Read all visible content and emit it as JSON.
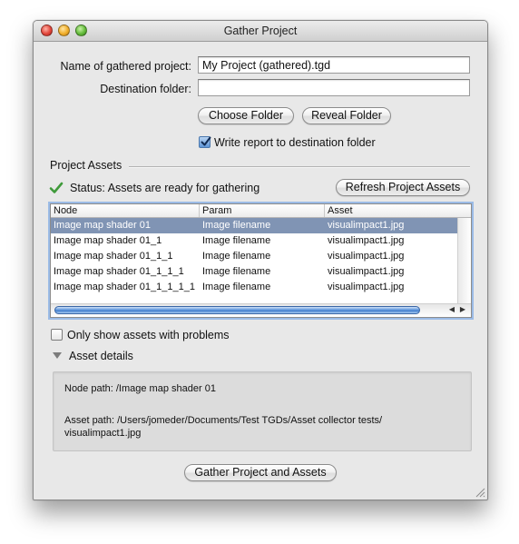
{
  "window": {
    "title": "Gather Project"
  },
  "form": {
    "name_label": "Name of gathered project:",
    "name_value": "My Project (gathered).tgd",
    "dest_label": "Destination folder:",
    "dest_value": "",
    "choose_folder": "Choose Folder",
    "reveal_folder": "Reveal Folder",
    "write_report_label": "Write report to destination folder",
    "write_report_checked": true
  },
  "assets": {
    "section_title": "Project Assets",
    "status": "Status: Assets are ready for gathering",
    "refresh": "Refresh Project Assets",
    "columns": [
      "Node",
      "Param",
      "Asset"
    ],
    "rows": [
      {
        "node": "Image map shader 01",
        "param": "Image filename",
        "asset": "visualimpact1.jpg",
        "selected": true
      },
      {
        "node": "Image map shader 01_1",
        "param": "Image filename",
        "asset": "visualimpact1.jpg",
        "selected": false
      },
      {
        "node": "Image map shader 01_1_1",
        "param": "Image filename",
        "asset": "visualimpact1.jpg",
        "selected": false
      },
      {
        "node": "Image map shader 01_1_1_1",
        "param": "Image filename",
        "asset": "visualimpact1.jpg",
        "selected": false
      },
      {
        "node": "Image map shader 01_1_1_1_1",
        "param": "Image filename",
        "asset": "visualimpact1.jpg",
        "selected": false
      }
    ],
    "only_problems_label": "Only show assets with problems",
    "only_problems_checked": false
  },
  "details": {
    "title": "Asset details",
    "node_path": "Node path: /Image map shader 01",
    "asset_path_line1": "Asset path: /Users/jomeder/Documents/Test TGDs/Asset collector tests/",
    "asset_path_line2": "visualimpact1.jpg"
  },
  "footer": {
    "gather": "Gather Project and Assets"
  }
}
